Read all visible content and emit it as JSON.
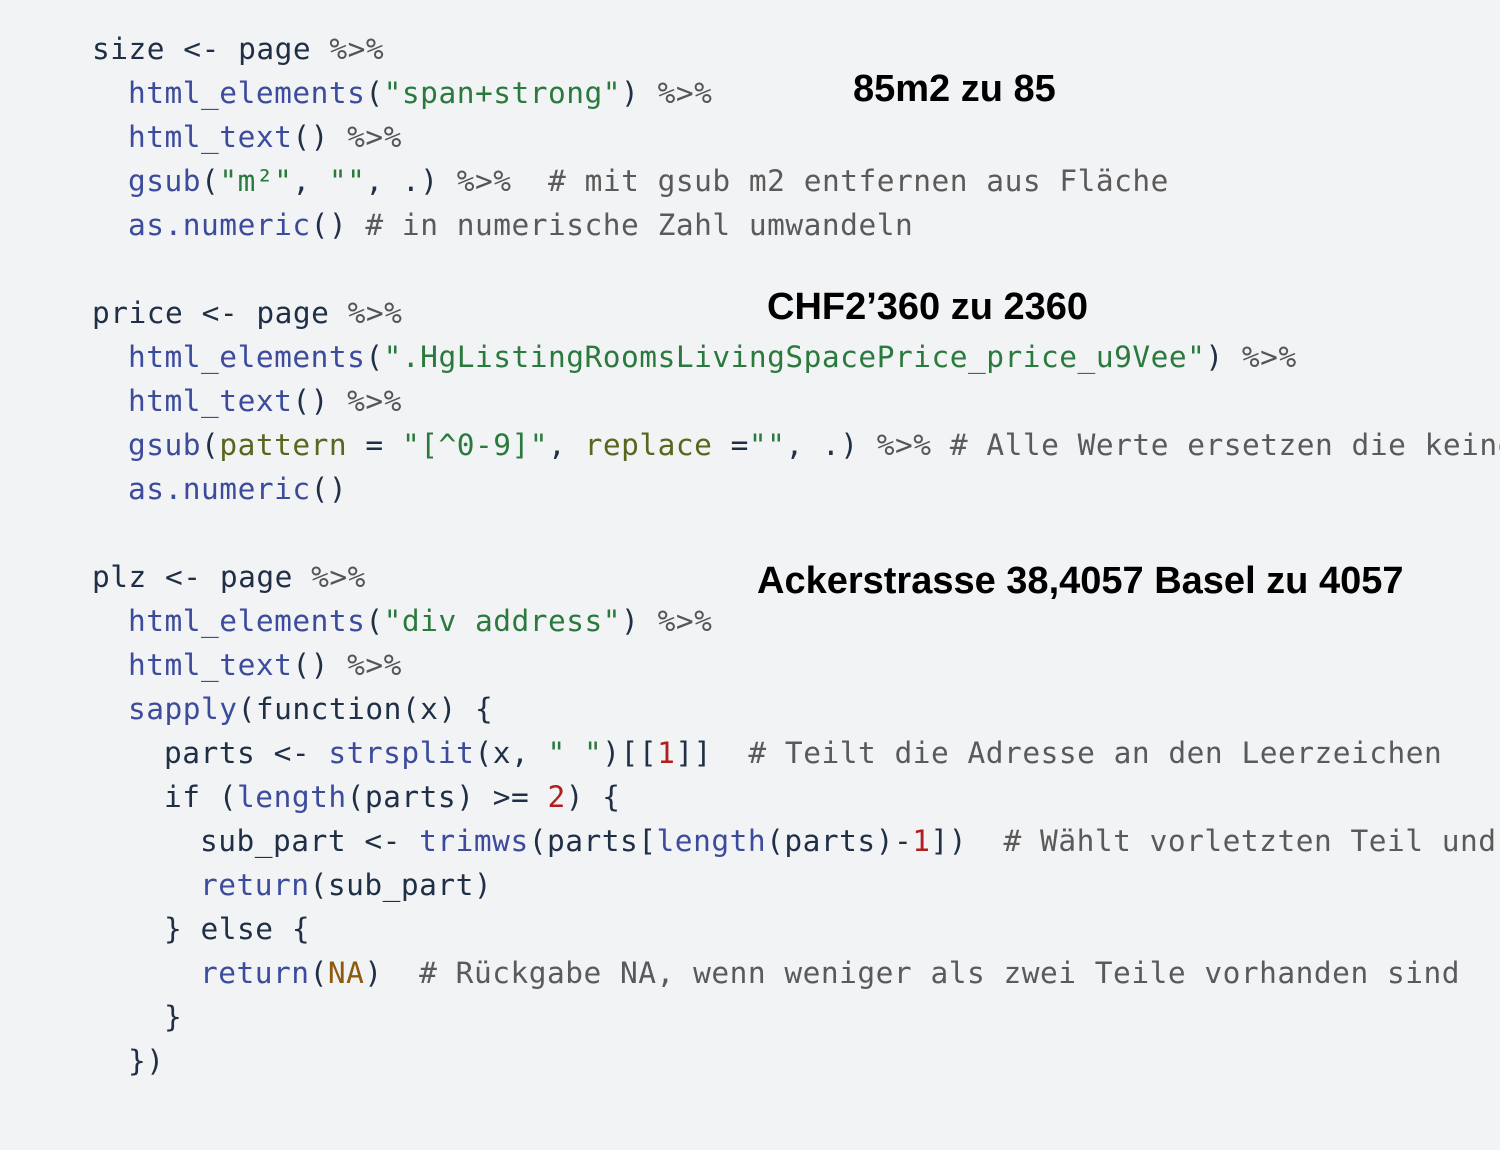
{
  "annotations": {
    "size": "85m2 zu 85",
    "price": "CHF2’360 zu 2360",
    "plz": "Ackerstrasse 38,4057 Basel zu 4057"
  },
  "code": {
    "l01": "size <- page ",
    "l01_op": "%>%",
    "l02_fn": "html_elements",
    "l02_p1": "(",
    "l02_str": "\"span+strong\"",
    "l02_p2": ") ",
    "l02_op": "%>%",
    "l03_fn": "html_text",
    "l03_p": "() ",
    "l03_op": "%>%",
    "l04_fn": "gsub",
    "l04_p1": "(",
    "l04_s1": "\"m²\"",
    "l04_p2": ", ",
    "l04_s2": "\"\"",
    "l04_p3": ", .) ",
    "l04_op": "%>%",
    "l04_cm": "  # mit gsub m2 entfernen aus Fläche",
    "l05_fn": "as.numeric",
    "l05_p": "() ",
    "l05_cm": "# in numerische Zahl umwandeln",
    "l07": "price <- page ",
    "l07_op": "%>%",
    "l08_fn": "html_elements",
    "l08_p1": "(",
    "l08_str": "\".HgListingRoomsLivingSpacePrice_price_u9Vee\"",
    "l08_p2": ") ",
    "l08_op": "%>%",
    "l09_fn": "html_text",
    "l09_p": "() ",
    "l09_op": "%>%",
    "l10_fn": "gsub",
    "l10_p1": "(",
    "l10_a1": "pattern",
    "l10_p2": " = ",
    "l10_s1": "\"[^0-9]\"",
    "l10_p3": ", ",
    "l10_a2": "replace",
    "l10_p4": " =",
    "l10_s2": "\"\"",
    "l10_p5": ", .) ",
    "l10_op": "%>%",
    "l10_cm": " # Alle Werte ersetzen die keine",
    "l11_fn": "as.numeric",
    "l11_p": "()",
    "l13": "plz <- page ",
    "l13_op": "%>%",
    "l14_fn": "html_elements",
    "l14_p1": "(",
    "l14_str": "\"div address\"",
    "l14_p2": ") ",
    "l14_op": "%>%",
    "l15_fn": "html_text",
    "l15_p": "() ",
    "l15_op": "%>%",
    "l16_fn": "sapply",
    "l16_p": "(function(x) {",
    "l17_p1": "parts <- ",
    "l17_fn": "strsplit",
    "l17_p2": "(x, ",
    "l17_str": "\" \"",
    "l17_p3": ")[[",
    "l17_num": "1",
    "l17_p4": "]]",
    "l17_cm": "  # Teilt die Adresse an den Leerzeichen",
    "l18_p1": "if (",
    "l18_fn": "length",
    "l18_p2": "(parts) >= ",
    "l18_num": "2",
    "l18_p3": ") {",
    "l19_p1": "sub_part <- ",
    "l19_fn1": "trimws",
    "l19_p2": "(parts[",
    "l19_fn2": "length",
    "l19_p3": "(parts)-",
    "l19_num": "1",
    "l19_p4": "])",
    "l19_cm": "  # Wählt vorletzten Teil und e",
    "l20_fn": "return",
    "l20_p": "(sub_part)",
    "l21": "} else {",
    "l22_fn": "return",
    "l22_p1": "(",
    "l22_na": "NA",
    "l22_p2": ")",
    "l22_cm": "  # Rückgabe NA, wenn weniger als zwei Teile vorhanden sind",
    "l23": "}",
    "l24": "})"
  }
}
